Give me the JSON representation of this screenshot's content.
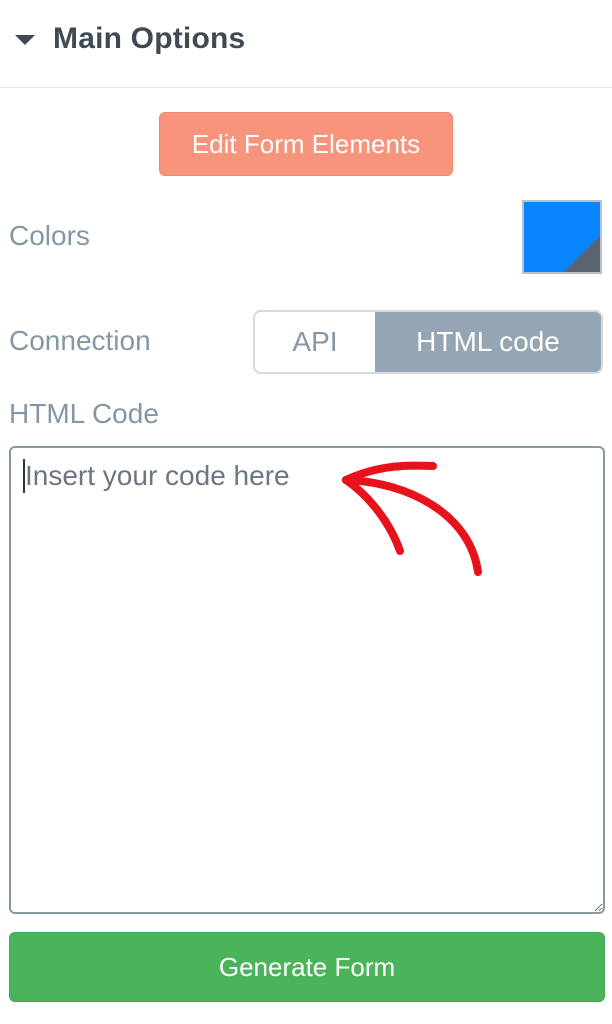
{
  "header": {
    "title": "Main Options",
    "icon": "caret-down-icon"
  },
  "edit_button": {
    "label": "Edit Form Elements",
    "color": "#f7947b"
  },
  "colors": {
    "label": "Colors",
    "swatch_color": "#0a84ff",
    "corner_color": "#5b636d"
  },
  "connection": {
    "label": "Connection",
    "options": [
      "API",
      "HTML code"
    ],
    "selected": "HTML code"
  },
  "html_code": {
    "label": "HTML Code",
    "placeholder": "Insert your code here",
    "value": ""
  },
  "generate_button": {
    "label": "Generate Form",
    "color": "#4bb35a"
  },
  "annotation": {
    "arrow_color": "#e8121c"
  }
}
